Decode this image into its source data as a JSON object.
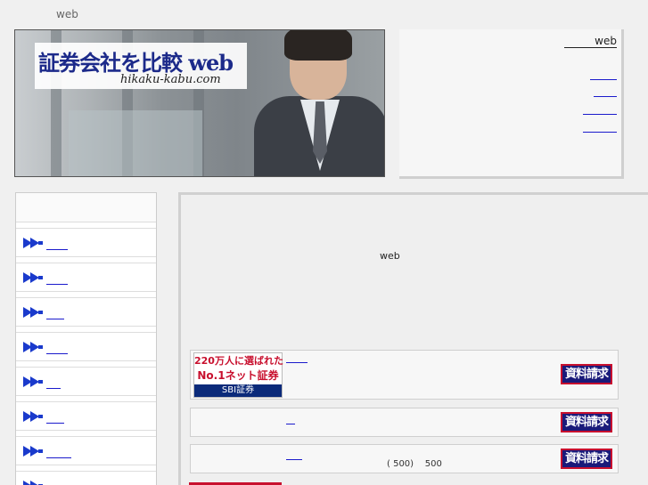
{
  "header": {
    "top_title": "web"
  },
  "banner": {
    "title": "証券会社を比較 web",
    "subtitle": "hikaku-kabu.com"
  },
  "right_panel": {
    "site_name": "web"
  },
  "main": {
    "web_text": "web",
    "cards": [
      {
        "logo_top": "220万人に選ばれた",
        "logo_mid": "No.1ネット証券",
        "logo_bottom": "SBI証券",
        "request_label": "資料請求"
      },
      {
        "request_label": "資料請求"
      },
      {
        "note": "( 500)    500",
        "request_label": "資料請求"
      }
    ]
  },
  "colors": {
    "link": "#1a1acc",
    "arrow": "#1a3acc",
    "request_bg": "#1a1a7a",
    "request_border": "#c8102e",
    "sbi_red": "#c8102e",
    "sbi_navy": "#0b2a7a"
  },
  "icons": {
    "nav_arrow": "double-arrow-right-icon"
  }
}
